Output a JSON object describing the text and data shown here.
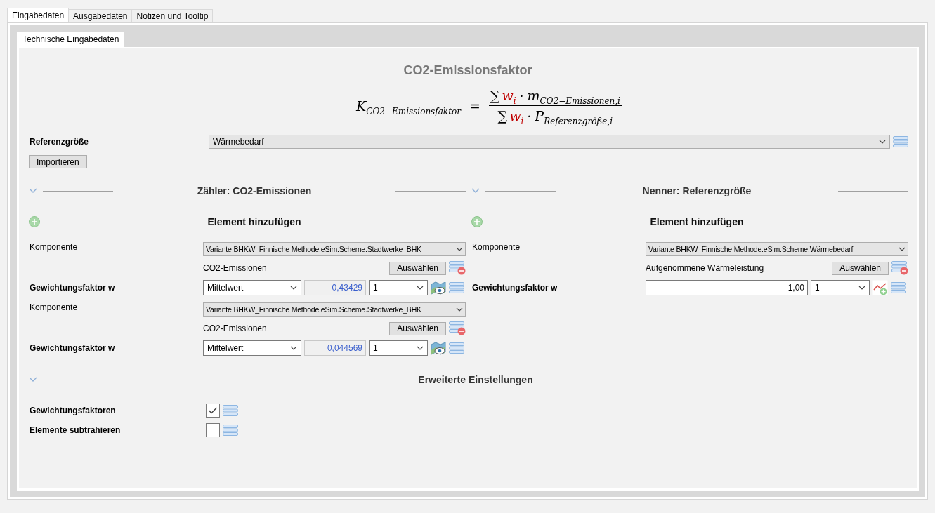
{
  "tabs": [
    {
      "label": "Eingabedaten",
      "selected": true
    },
    {
      "label": "Ausgabedaten",
      "selected": false
    },
    {
      "label": "Notizen und Tooltip",
      "selected": false
    }
  ],
  "subtabs": [
    {
      "label": "Technische Eingabedaten",
      "selected": true
    }
  ],
  "title": "CO2-Emissionsfaktor",
  "formula": {
    "symbol": "K",
    "subscript": "CO2−Emissionsfaktor",
    "equals": "=",
    "numerator": {
      "sum": "∑",
      "weight": "w",
      "weight_index": "i",
      "dot": "·",
      "symbol": "m",
      "subscript": "CO2−Emissionen,i"
    },
    "denominator": {
      "sum": "∑",
      "weight": "w",
      "weight_index": "i",
      "dot": "·",
      "symbol": "P",
      "subscript": "Referenzgröße,i"
    }
  },
  "reference": {
    "label": "Referenzgröße",
    "value": "Wärmebedarf"
  },
  "import_button": "Importieren",
  "sections": [
    {
      "title": "Zähler: CO2-Emissionen",
      "expanded": true,
      "add_label": "Element hinzufügen",
      "entries": [
        {
          "component_label": "Komponente",
          "component": "Variante BHKW_Finnische Methode.eSim.Scheme.Stadtwerke_BHK",
          "quantity": "CO2-Emissionen",
          "select_button": "Auswählen",
          "weight_label": "Gewichtungsfaktor w",
          "weight": {
            "kind": "computed",
            "mode": "Mittelwert",
            "value": "0,43429",
            "multiplier": "1"
          }
        },
        {
          "component_label": "Komponente",
          "component": "Variante BHKW_Finnische Methode.eSim.Scheme.Stadtwerke_BHK",
          "quantity": "CO2-Emissionen",
          "select_button": "Auswählen",
          "weight_label": "Gewichtungsfaktor w",
          "weight": {
            "kind": "computed",
            "mode": "Mittelwert",
            "value": "0,044569",
            "multiplier": "1"
          }
        }
      ]
    },
    {
      "title": "Nenner: Referenzgröße",
      "expanded": true,
      "add_label": "Element hinzufügen",
      "entries": [
        {
          "component_label": "Komponente",
          "component": "Variante BHKW_Finnische Methode.eSim.Scheme.Wärmebedarf",
          "quantity": "Aufgenommene Wärmeleistung",
          "select_button": "Auswählen",
          "weight_label": "Gewichtungsfaktor w",
          "weight": {
            "kind": "manual",
            "value": "1,00",
            "multiplier": "1"
          }
        }
      ]
    }
  ],
  "advanced": {
    "title": "Erweiterte Einstellungen",
    "expanded": true,
    "options": [
      {
        "label": "Gewichtungsfaktoren",
        "checked": true
      },
      {
        "label": "Elemente subtrahieren",
        "checked": false
      }
    ]
  }
}
